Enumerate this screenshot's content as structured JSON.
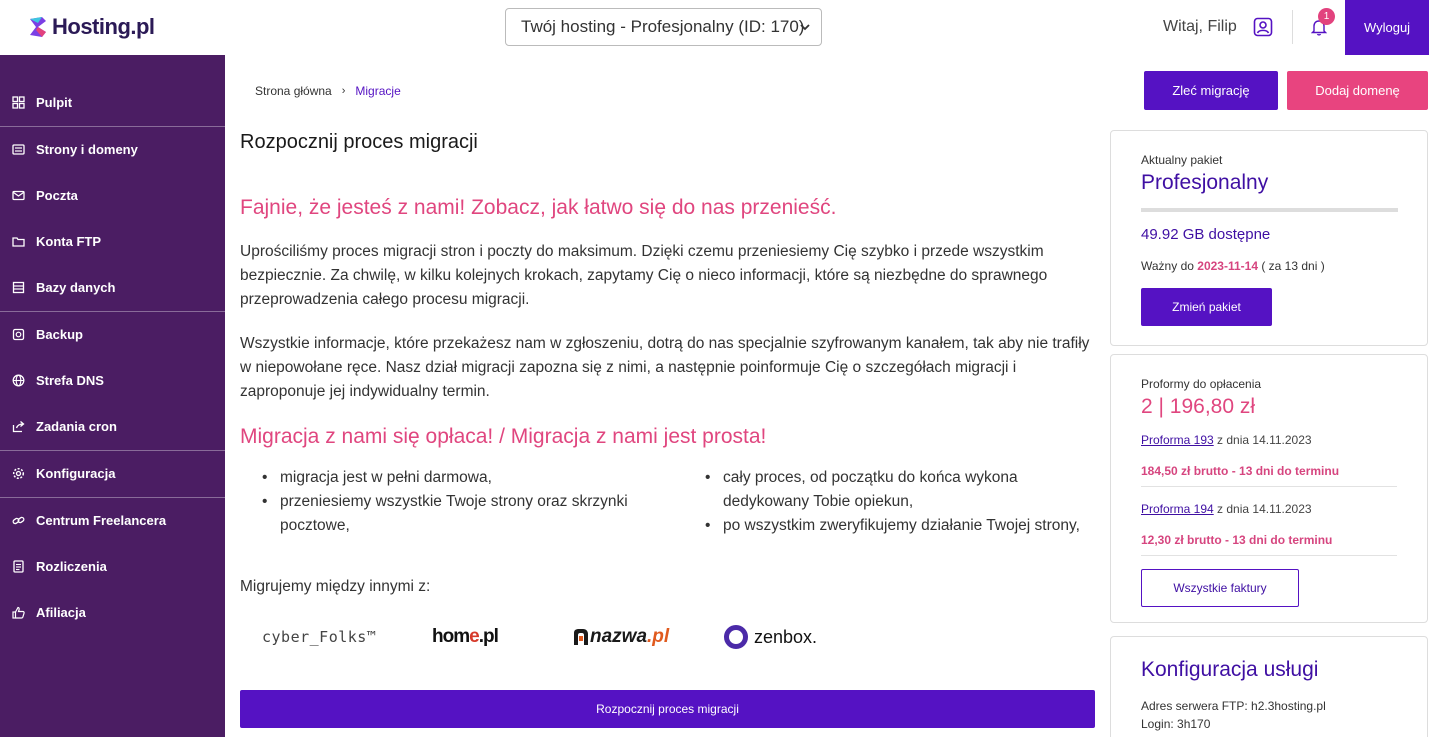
{
  "header": {
    "logo_text": "Hosting.pl",
    "hosting_select": "Twój hosting - Profesjonalny (ID: 170)",
    "greeting": "Witaj, Filip",
    "notification_count": "1",
    "logout_label": "Wyloguj"
  },
  "sidebar": {
    "items": [
      {
        "label": "Pulpit",
        "icon": "dashboard-icon"
      },
      {
        "label": "Strony i domeny",
        "icon": "pages-icon"
      },
      {
        "label": "Poczta",
        "icon": "mail-icon"
      },
      {
        "label": "Konta FTP",
        "icon": "folder-icon"
      },
      {
        "label": "Bazy danych",
        "icon": "database-icon"
      },
      {
        "label": "Backup",
        "icon": "backup-icon"
      },
      {
        "label": "Strefa DNS",
        "icon": "globe-icon"
      },
      {
        "label": "Zadania cron",
        "icon": "share-arrow-icon"
      },
      {
        "label": "Konfiguracja",
        "icon": "gear-icon"
      },
      {
        "label": "Centrum Freelancera",
        "icon": "link-icon"
      },
      {
        "label": "Rozliczenia",
        "icon": "document-icon"
      },
      {
        "label": "Afiliacja",
        "icon": "thumbs-up-icon"
      }
    ]
  },
  "breadcrumb": {
    "home": "Strona główna",
    "separator": "›",
    "current": "Migracje"
  },
  "actions": {
    "order_migration": "Zleć migrację",
    "add_domain": "Dodaj domenę"
  },
  "main": {
    "title": "Rozpocznij proces migracji",
    "heading1": "Fajnie, że jesteś z nami! Zobacz, jak łatwo się do nas przenieść.",
    "para1": "Uprościliśmy proces migracji stron i poczty do maksimum. Dzięki czemu przeniesiemy Cię szybko i przede wszystkim bezpiecznie. Za chwilę, w kilku kolejnych krokach, zapytamy Cię o nieco informacji, które są niezbędne do sprawnego przeprowadzenia całego procesu migracji.",
    "para2": "Wszystkie informacje, które przekażesz nam w zgłoszeniu, dotrą do nas specjalnie szyfrowanym kanałem, tak aby nie trafiły w niepowołane ręce. Nasz dział migracji zapozna się z nimi, a następnie poinformuje Cię o szczegółach migracji i zaproponuje jej indywidualny termin.",
    "heading2": "Migracja z nami się opłaca! / Migracja z nami jest prosta!",
    "bullets_left": [
      "migracja jest w pełni darmowa,",
      "przeniesiemy wszystkie Twoje strony oraz skrzynki pocztowe,"
    ],
    "bullets_right": [
      "cały proces, od początku do końca wykona dedykowany Tobie opiekun,",
      "po wszystkim zweryfikujemy działanie Twojej strony,"
    ],
    "migrate_between": "Migrujemy między innymi z:",
    "brands": {
      "cyber": "cyber_Folks™",
      "home_a": "hom",
      "home_b": "e",
      "home_c": ".pl",
      "nazwa_a": "nazwa",
      "nazwa_b": ".pl",
      "zenbox": "zenbox."
    },
    "start_button": "Rozpocznij proces migracji"
  },
  "package_card": {
    "label": "Aktualny pakiet",
    "name": "Profesjonalny",
    "usage_fraction": 0.0,
    "available": "49.92 GB dostępne",
    "valid_prefix": "Ważny do",
    "valid_date": "2023-11-14",
    "valid_suffix": "( za 13 dni )",
    "change_button": "Zmień pakiet"
  },
  "proforma_card": {
    "label": "Proformy do opłacenia",
    "total": "2 | 196,80 zł",
    "items": [
      {
        "link": "Proforma 193",
        "date_text": "z dnia 14.11.2023",
        "amount": "184,50 zł brutto - 13 dni do terminu"
      },
      {
        "link": "Proforma 194",
        "date_text": "z dnia 14.11.2023",
        "amount": "12,30 zł brutto - 13 dni do terminu"
      }
    ],
    "all_invoices": "Wszystkie faktury"
  },
  "config_card": {
    "title": "Konfiguracja usługi",
    "ftp_address": "Adres serwera FTP: h2.3hosting.pl",
    "login": "Login: 3h170"
  },
  "colors": {
    "sidebar_bg": "#4b1d63",
    "primary": "#5512c3",
    "accent_pink": "#e8447f"
  }
}
